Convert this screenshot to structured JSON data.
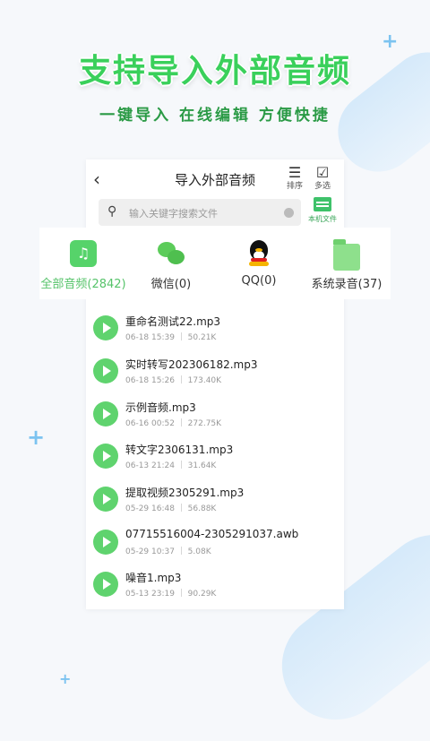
{
  "promo": {
    "title": "支持导入外部音频",
    "subtitle": "一键导入 在线编辑 方便快捷"
  },
  "header": {
    "back_icon": "chevron-left-icon",
    "title": "导入外部音频",
    "sort_label": "排序",
    "multi_label": "多选"
  },
  "search": {
    "placeholder": "输入关键字搜索文件"
  },
  "local_files": {
    "label": "本机文件"
  },
  "categories": [
    {
      "label": "全部音频(2842)",
      "icon": "music-note-icon",
      "active": true
    },
    {
      "label": "微信(0)",
      "icon": "wechat-icon",
      "active": false
    },
    {
      "label": "QQ(0)",
      "icon": "qq-penguin-icon",
      "active": false
    },
    {
      "label": "系统录音(37)",
      "icon": "folder-icon",
      "active": false
    }
  ],
  "files": [
    {
      "name": "重命名测试22.mp3",
      "meta": "06-18 15:39 ｜ 50.21K"
    },
    {
      "name": "实时转写202306182.mp3",
      "meta": "06-18 15:26 ｜ 173.40K"
    },
    {
      "name": "示例音频.mp3",
      "meta": "06-16 00:52 ｜ 272.75K"
    },
    {
      "name": "转文字2306131.mp3",
      "meta": "06-13 21:24 ｜ 31.64K"
    },
    {
      "name": "提取视频2305291.mp3",
      "meta": "05-29 16:48 ｜ 56.88K"
    },
    {
      "name": "07715516004-2305291037.awb",
      "meta": "05-29 10:37 ｜ 5.08K"
    },
    {
      "name": "噪音1.mp3",
      "meta": "05-13 23:19 ｜ 90.29K"
    }
  ],
  "colors": {
    "accent": "#56d36a",
    "promo_title": "#3ad05b",
    "background": "#f6f8fb"
  }
}
